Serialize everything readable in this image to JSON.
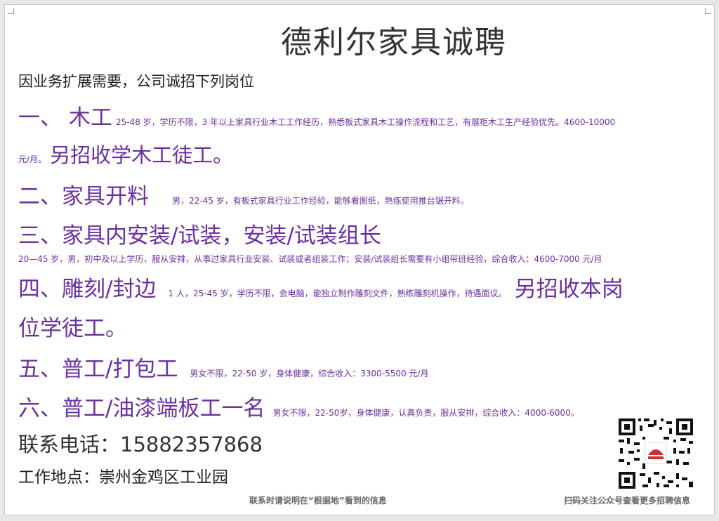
{
  "title": "德利尔家具诚聘",
  "intro": "因业务扩展需要，公司诚招下列岗位",
  "jobs": [
    {
      "heading": "一、 木工",
      "details_line1": "25-48 岁，学历不限，3 年以上家具行业木工工作经历，熟悉板式家具木工操作流程和工艺，有展柜木工生产经验优先。4600-10000",
      "details_line2": "元/月。",
      "extra": "另招收学木工徒工。"
    },
    {
      "heading": "二、家具开料",
      "details": "男，22-45 岁，有板式家具行业工作经验，能够看图纸，熟练使用推台锯开料。"
    },
    {
      "heading": "三、家具内安装/试装，安装/试装组长",
      "details": "20—45 岁，男，初中及以上学历，服从安排，从事过家具行业安装、试装或者组装工作；安装/试装组长需要有小组带班经验，综合收入：4600-7000 元/月"
    },
    {
      "heading": "四、雕刻/封边",
      "details": "1 人，25-45 岁，学历不限，会电脑，能独立制作雕刻文件，熟练雕刻机操作，待遇面议。",
      "extra_line1": "另招收本岗",
      "extra_line2": "位学徒工。"
    },
    {
      "heading": "五、普工/打包工",
      "details": "男女不限，22-50 岁，身体健康，综合收入：3300-5500 元/月"
    },
    {
      "heading": "六、普工/油漆端板工一名",
      "details": "男女不限，22-50岁，身体健康，认真负责，服从安排，综合收入：4000-6000。"
    }
  ],
  "contact": {
    "phone": "联系电话：15882357868",
    "address": "工作地点：崇州金鸡区工业园"
  },
  "footer": {
    "left": "联系时请说明在“根据地”看到的信息",
    "right": "扫码关注公众号查看更多招聘信息"
  },
  "colors": {
    "accent": "#6b2fa0",
    "title": "#333333",
    "text": "#222222"
  }
}
